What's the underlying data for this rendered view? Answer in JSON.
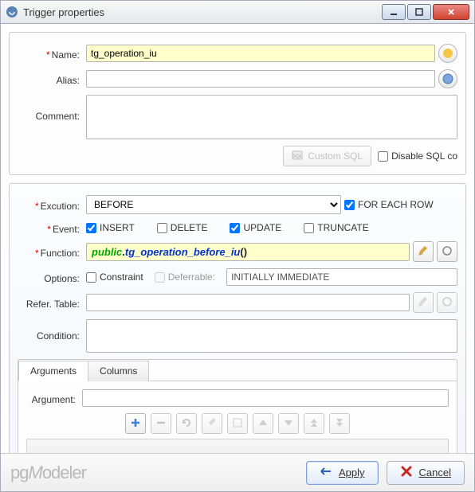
{
  "window": {
    "title": "Trigger properties"
  },
  "top": {
    "name_label": "Name:",
    "name_value": "tg_operation_iu",
    "alias_label": "Alias:",
    "alias_value": "",
    "comment_label": "Comment:",
    "comment_value": "",
    "custom_sql_label": "Custom SQL",
    "disable_sql_label": "Disable SQL co"
  },
  "exec": {
    "label": "Excution:",
    "value": "BEFORE",
    "for_each_row": "FOR EACH ROW",
    "for_each_row_checked": true
  },
  "event": {
    "label": "Event:",
    "insert": "INSERT",
    "insert_checked": true,
    "delete": "DELETE",
    "delete_checked": false,
    "update": "UPDATE",
    "update_checked": true,
    "truncate": "TRUNCATE",
    "truncate_checked": false
  },
  "function": {
    "label": "Function:",
    "schema": "public",
    "name": "tg_operation_before_iu"
  },
  "options": {
    "label": "Options:",
    "constraint": "Constraint",
    "deferrable": "Deferrable:",
    "deferrable_mode": "INITIALLY IMMEDIATE"
  },
  "refer": {
    "label": "Refer. Table:",
    "value": ""
  },
  "condition": {
    "label": "Condition:",
    "value": ""
  },
  "tabs": {
    "arguments": "Arguments",
    "columns": "Columns",
    "argument_label": "Argument:",
    "argument_value": ""
  },
  "footer": {
    "brand_pg": "pg",
    "brand_m": "M",
    "brand_odeler": "odeler",
    "apply": "Apply",
    "cancel": "Cancel"
  },
  "icons": {
    "broom": "broom-icon",
    "plus": "plus-icon",
    "minus": "minus-icon",
    "refresh": "refresh-icon",
    "brush": "brush-icon",
    "edit": "edit-icon",
    "up": "up-icon",
    "down": "down-icon",
    "top": "top-icon",
    "bottom": "bottom-icon"
  }
}
